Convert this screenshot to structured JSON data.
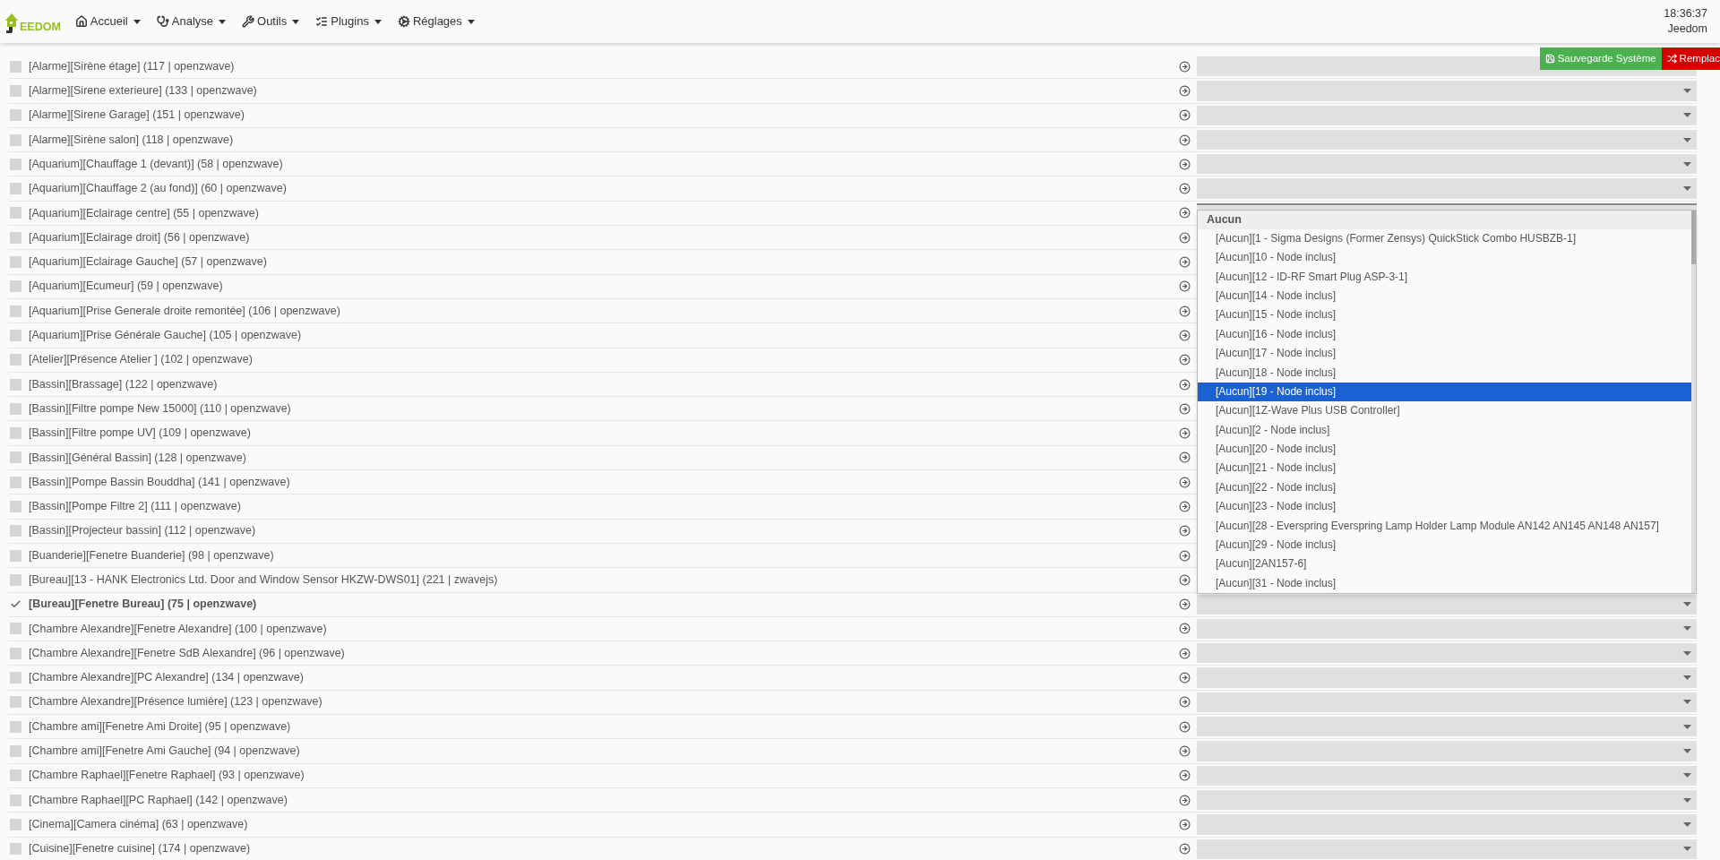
{
  "navbar": {
    "logo": "EEDOM",
    "menus": [
      {
        "label": "Accueil"
      },
      {
        "label": "Analyse"
      },
      {
        "label": "Outils"
      },
      {
        "label": "Plugins"
      },
      {
        "label": "Réglages"
      }
    ],
    "time": "18:36:37",
    "user": "Jeedom"
  },
  "actions": [
    {
      "kind": "save",
      "label": "Sauvegarde Système"
    },
    {
      "kind": "replace",
      "label": "Remplac"
    }
  ],
  "rows": [
    {
      "label": "[Alarme][Sirène étage] (117 | openzwave)",
      "checked": false,
      "open": false
    },
    {
      "label": "[Alarme][Sirene exterieure] (133 | openzwave)",
      "checked": false,
      "open": false
    },
    {
      "label": "[Alarme][Sirene Garage] (151 | openzwave)",
      "checked": false,
      "open": false
    },
    {
      "label": "[Alarme][Sirène salon] (118 | openzwave)",
      "checked": false,
      "open": false
    },
    {
      "label": "[Aquarium][Chauffage 1 (devant)] (58 | openzwave)",
      "checked": false,
      "open": false
    },
    {
      "label": "[Aquarium][Chauffage 2 (au fond)] (60 | openzwave)",
      "checked": false,
      "open": false
    },
    {
      "label": "[Aquarium][Eclairage centre] (55 | openzwave)",
      "checked": false,
      "open": true
    },
    {
      "label": "[Aquarium][Eclairage droit] (56 | openzwave)",
      "checked": false,
      "open": false
    },
    {
      "label": "[Aquarium][Eclairage Gauche] (57 | openzwave)",
      "checked": false,
      "open": false
    },
    {
      "label": "[Aquarium][Ecumeur] (59 | openzwave)",
      "checked": false,
      "open": false
    },
    {
      "label": "[Aquarium][Prise Generale droite remontée] (106 | openzwave)",
      "checked": false,
      "open": false
    },
    {
      "label": "[Aquarium][Prise Générale Gauche] (105 | openzwave)",
      "checked": false,
      "open": false
    },
    {
      "label": "[Atelier][Présence Atelier ] (102 | openzwave)",
      "checked": false,
      "open": false
    },
    {
      "label": "[Bassin][Brassage] (122 | openzwave)",
      "checked": false,
      "open": false
    },
    {
      "label": "[Bassin][Filtre pompe New 15000] (110 | openzwave)",
      "checked": false,
      "open": false
    },
    {
      "label": "[Bassin][Filtre pompe UV] (109 | openzwave)",
      "checked": false,
      "open": false
    },
    {
      "label": "[Bassin][Général Bassin] (128 | openzwave)",
      "checked": false,
      "open": false
    },
    {
      "label": "[Bassin][Pompe Bassin Bouddha] (141 | openzwave)",
      "checked": false,
      "open": false
    },
    {
      "label": "[Bassin][Pompe Filtre 2] (111 | openzwave)",
      "checked": false,
      "open": false
    },
    {
      "label": "[Bassin][Projecteur bassin] (112 | openzwave)",
      "checked": false,
      "open": false
    },
    {
      "label": "[Buanderie][Fenetre Buanderie] (98 | openzwave)",
      "checked": false,
      "open": false
    },
    {
      "label": "[Bureau][13 - HANK Electronics Ltd. Door and Window Sensor HKZW-DWS01] (221 | zwavejs)",
      "checked": false,
      "open": false
    },
    {
      "label": "[Bureau][Fenetre Bureau] (75 | openzwave)",
      "checked": true,
      "open": false
    },
    {
      "label": "[Chambre Alexandre][Fenetre Alexandre] (100 | openzwave)",
      "checked": false,
      "open": false
    },
    {
      "label": "[Chambre Alexandre][Fenetre SdB Alexandre] (96 | openzwave)",
      "checked": false,
      "open": false
    },
    {
      "label": "[Chambre Alexandre][PC Alexandre] (134 | openzwave)",
      "checked": false,
      "open": false
    },
    {
      "label": "[Chambre Alexandre][Présence lumière] (123 | openzwave)",
      "checked": false,
      "open": false
    },
    {
      "label": "[Chambre ami][Fenetre Ami Droite] (95 | openzwave)",
      "checked": false,
      "open": false
    },
    {
      "label": "[Chambre ami][Fenetre Ami Gauche] (94 | openzwave)",
      "checked": false,
      "open": false
    },
    {
      "label": "[Chambre Raphael][Fenetre Raphael] (93 | openzwave)",
      "checked": false,
      "open": false
    },
    {
      "label": "[Chambre Raphael][PC Raphael] (142 | openzwave)",
      "checked": false,
      "open": false
    },
    {
      "label": "[Cinema][Camera cinéma] (63 | openzwave)",
      "checked": false,
      "open": false
    },
    {
      "label": "[Cuisine][Fenetre cuisine] (174 | openzwave)",
      "checked": false,
      "open": false
    }
  ],
  "dropdown": {
    "group": "Aucun",
    "options": [
      {
        "label": "[Aucun][1 - Sigma Designs (Former Zensys) QuickStick Combo HUSBZB-1]",
        "selected": false
      },
      {
        "label": "[Aucun][10 - Node inclus]",
        "selected": false
      },
      {
        "label": "[Aucun][12 - ID-RF Smart Plug ASP-3-1]",
        "selected": false
      },
      {
        "label": "[Aucun][14 - Node inclus]",
        "selected": false
      },
      {
        "label": "[Aucun][15 - Node inclus]",
        "selected": false
      },
      {
        "label": "[Aucun][16 - Node inclus]",
        "selected": false
      },
      {
        "label": "[Aucun][17 - Node inclus]",
        "selected": false
      },
      {
        "label": "[Aucun][18 - Node inclus]",
        "selected": false
      },
      {
        "label": "[Aucun][19 - Node inclus]",
        "selected": true
      },
      {
        "label": "[Aucun][1Z-Wave Plus USB Controller]",
        "selected": false
      },
      {
        "label": "[Aucun][2 - Node inclus]",
        "selected": false
      },
      {
        "label": "[Aucun][20 - Node inclus]",
        "selected": false
      },
      {
        "label": "[Aucun][21 - Node inclus]",
        "selected": false
      },
      {
        "label": "[Aucun][22 - Node inclus]",
        "selected": false
      },
      {
        "label": "[Aucun][23 - Node inclus]",
        "selected": false
      },
      {
        "label": "[Aucun][28 - Everspring Everspring Lamp Holder Lamp Module AN142 AN145 AN148 AN157]",
        "selected": false
      },
      {
        "label": "[Aucun][29 - Node inclus]",
        "selected": false
      },
      {
        "label": "[Aucun][2AN157-6]",
        "selected": false
      },
      {
        "label": "[Aucun][31 - Node inclus]",
        "selected": false
      }
    ]
  }
}
